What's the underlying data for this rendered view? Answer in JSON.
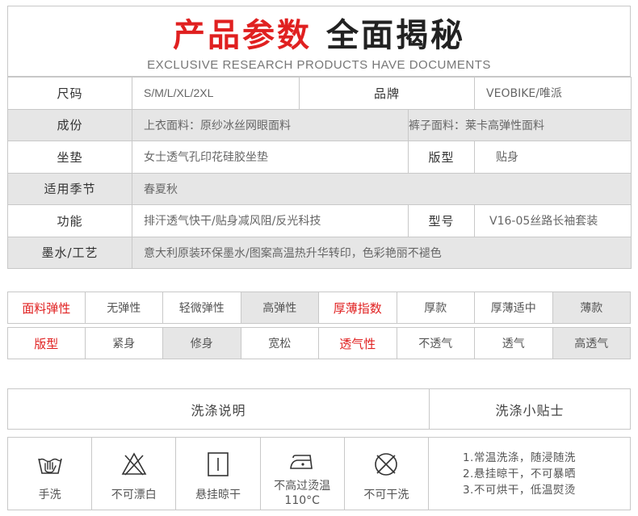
{
  "header": {
    "title_red": "产品参数",
    "title_black": "全面揭秘",
    "subtitle": "EXCLUSIVE RESEARCH PRODUCTS HAVE DOCUMENTS"
  },
  "params": {
    "size_label": "尺码",
    "size_value": "S/M/L/XL/2XL",
    "brand_label": "品牌",
    "brand_value": "VEOBIKE/唯派",
    "material_label": "成份",
    "material_top": "上衣面料：原纱冰丝网眼面料",
    "material_pants": "裤子面料：莱卡高弹性面料",
    "pad_label": "坐垫",
    "pad_value": "女士透气孔印花硅胶坐垫",
    "fit_label": "版型",
    "fit_value": "贴身",
    "season_label": "适用季节",
    "season_value": "春夏秋",
    "function_label": "功能",
    "function_value": "排汗透气快干/贴身减风阻/反光科技",
    "model_label": "型号",
    "model_value": "V16-05丝路长袖套装",
    "ink_label": "墨水/工艺",
    "ink_value": "意大利原装环保墨水/图案高温热升华转印，色彩艳丽不褪色"
  },
  "attributes": {
    "row1": {
      "elastic_label": "面料弹性",
      "elastic_options": [
        "无弹性",
        "轻微弹性",
        "高弹性"
      ],
      "elastic_selected": 2,
      "thickness_label": "厚薄指数",
      "thickness_options": [
        "厚款",
        "厚薄适中",
        "薄款"
      ],
      "thickness_selected": 2
    },
    "row2": {
      "fit_label": "版型",
      "fit_options": [
        "紧身",
        "修身",
        "宽松"
      ],
      "fit_selected": 1,
      "breath_label": "透气性",
      "breath_options": [
        "不透气",
        "透气",
        "高透气"
      ],
      "breath_selected": 2
    }
  },
  "washing": {
    "instructions_label": "洗涤说明",
    "tips_label": "洗涤小贴士",
    "icons": [
      {
        "icon": "hand-wash-icon",
        "caption": "手洗"
      },
      {
        "icon": "no-bleach-icon",
        "caption": "不可漂白"
      },
      {
        "icon": "hang-dry-icon",
        "caption": "悬挂晾干"
      },
      {
        "icon": "iron-low-icon",
        "caption": "不高过烫温",
        "caption2": "110°C"
      },
      {
        "icon": "no-dry-clean-icon",
        "caption": "不可干洗"
      }
    ],
    "tips": [
      "1.常温洗涤，随浸随洗",
      "2.悬挂晾干，不可暴晒",
      "3.不可烘干，低温熨烫"
    ]
  }
}
